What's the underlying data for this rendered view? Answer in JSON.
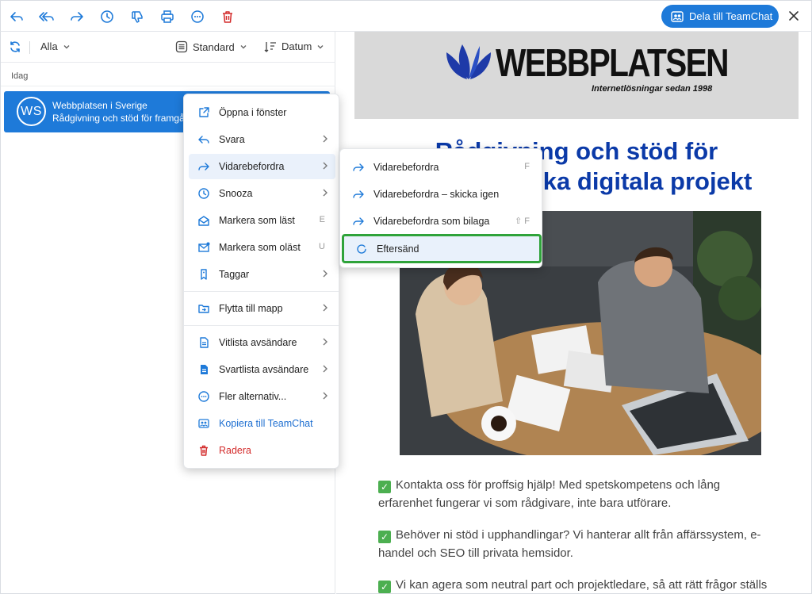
{
  "toolbar": {
    "icons": [
      "reply-icon",
      "reply-all-icon",
      "forward-icon",
      "clock-icon",
      "thumbs-down-icon",
      "print-icon",
      "more-icon",
      "trash-icon"
    ],
    "share_button": "Dela till TeamChat"
  },
  "list": {
    "filter": "Alla",
    "view": "Standard",
    "sort": "Datum",
    "group": "Idag",
    "item": {
      "initials": "WS",
      "sender": "Webbplatsen i Sverige",
      "subject": "Rådgivning och stöd för framgångsrika digitala projekt"
    }
  },
  "email": {
    "logo_name": "WEBBPLATSEN",
    "logo_tagline": "Internetlösningar sedan 1998",
    "headline_line1": "Rådgivning och stöd för",
    "headline_line2": "framgångsrika digitala projekt",
    "paragraphs": [
      "Kontakta oss för proffsig hjälp! Med spetskompetens och lång erfarenhet fungerar vi som rådgivare, inte bara utförare.",
      "Behöver ni stöd i upphandlingar? Vi hanterar allt från affärssystem, e-handel och SEO till privata hemsidor.",
      "Vi kan agera som neutral part och projektledare, så att rätt frågor ställs"
    ]
  },
  "context_menu": {
    "open_window": "Öppna i fönster",
    "reply": "Svara",
    "forward": "Vidarebefordra",
    "snooze": "Snooza",
    "mark_read": "Markera som läst",
    "mark_read_key": "E",
    "mark_unread": "Markera som oläst",
    "mark_unread_key": "U",
    "tags": "Taggar",
    "move": "Flytta till mapp",
    "whitelist": "Vitlista avsändare",
    "blacklist": "Svartlista avsändare",
    "more": "Fler alternativ...",
    "copy_teamchat": "Kopiera till TeamChat",
    "delete": "Radera"
  },
  "submenu": {
    "forward": "Vidarebefordra",
    "forward_key": "F",
    "forward_again": "Vidarebefordra – skicka igen",
    "forward_attachment": "Vidarebefordra som bilaga",
    "forward_attachment_key": "⇧ F",
    "redirect": "Eftersänd"
  },
  "colors": {
    "accent": "#1e7ad9",
    "headline": "#0b3aa8",
    "delete": "#d32b2b",
    "highlight_border": "#2fa33a"
  }
}
